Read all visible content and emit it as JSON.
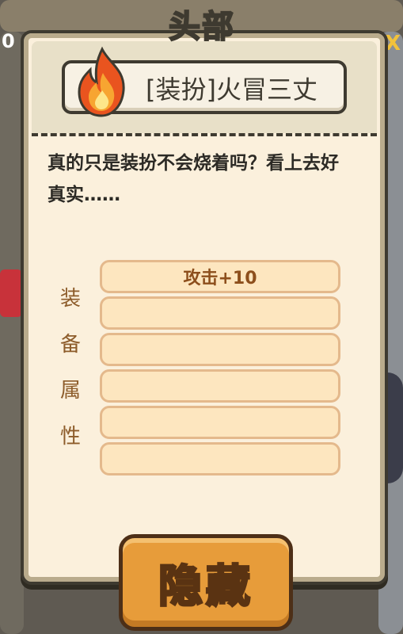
{
  "background": {
    "left_number": "0",
    "right_close_glyph": "X"
  },
  "panel": {
    "title": "头部",
    "item_name": "[装扮]火冒三丈",
    "description": "真的只是装扮不会烧着吗？看上去好真实……",
    "attributes_label": [
      "装",
      "备",
      "属",
      "性"
    ],
    "attribute_slots": [
      "攻击+10",
      "",
      "",
      "",
      "",
      ""
    ],
    "hide_button": "隐藏"
  },
  "colors": {
    "panel_bg": "#fbf0dc",
    "border": "#3e3a30",
    "slot_fill": "#fde6bf",
    "slot_text": "#8d4f1c",
    "button": "#e79c3a"
  },
  "icons": {
    "item": "fire-icon"
  }
}
